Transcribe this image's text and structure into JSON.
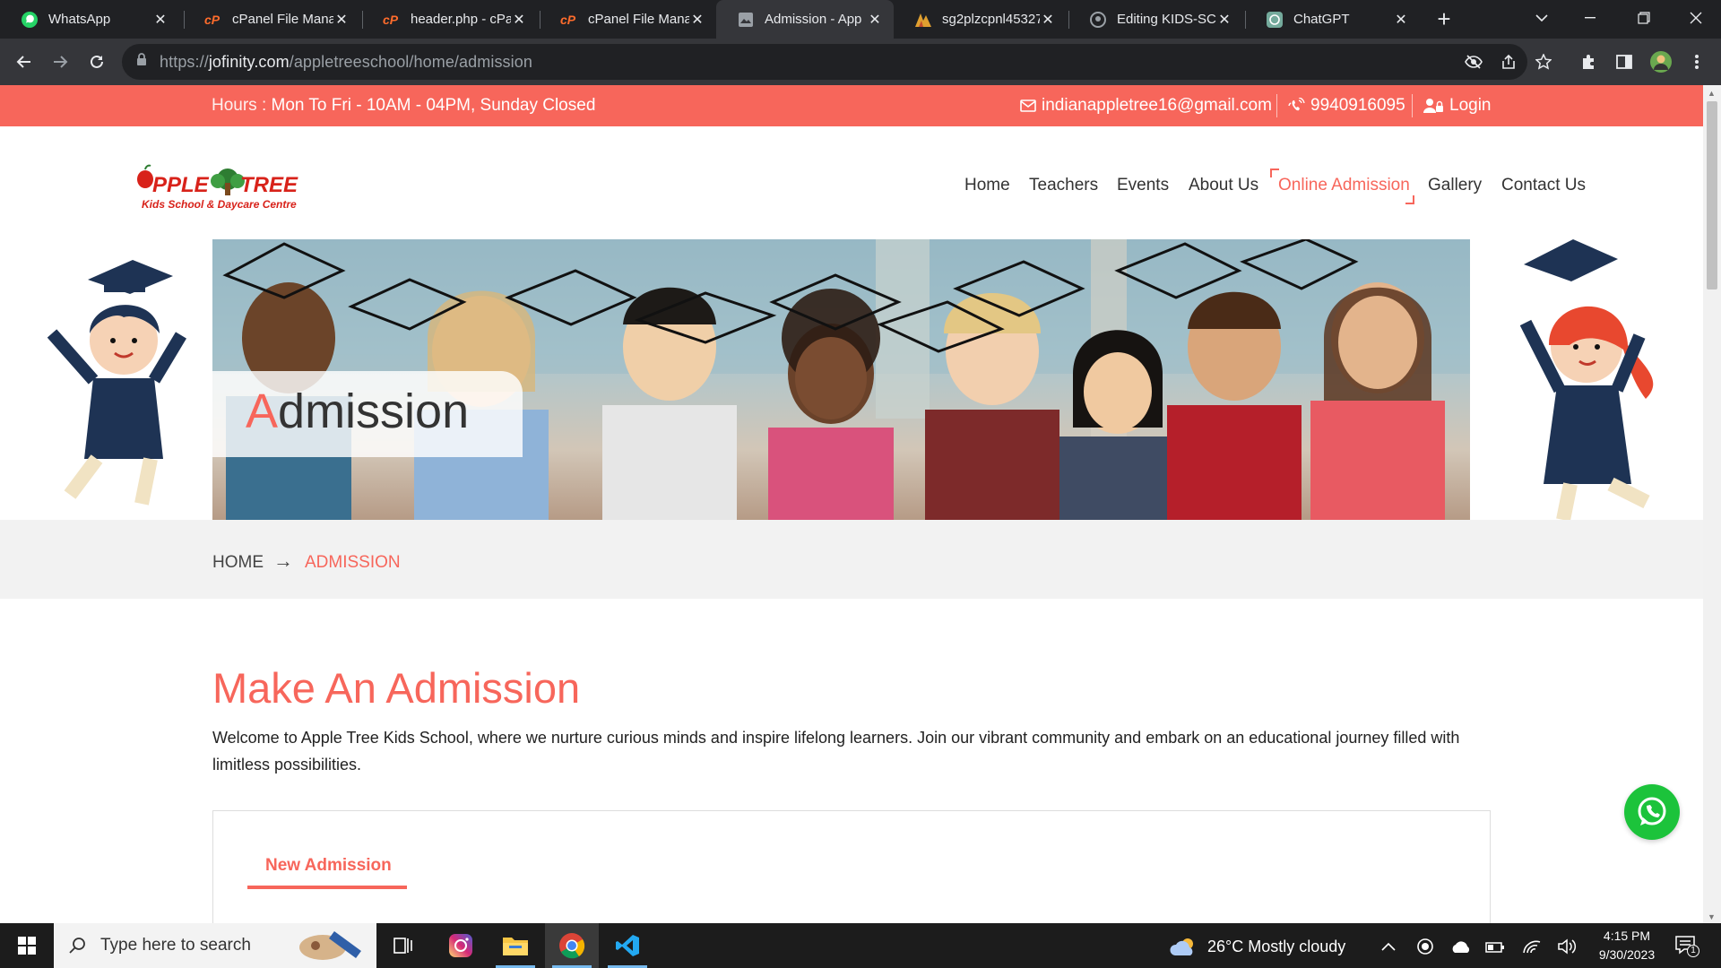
{
  "browser": {
    "tabs": [
      {
        "title": "WhatsApp",
        "icon": "whatsapp-icon"
      },
      {
        "title": "cPanel File Mana",
        "icon": "cpanel-icon"
      },
      {
        "title": "header.php - cPa",
        "icon": "cpanel-icon"
      },
      {
        "title": "cPanel File Mana",
        "icon": "cpanel-icon"
      },
      {
        "title": "Admission - App",
        "icon": "page-icon",
        "active": true
      },
      {
        "title": "sg2plzcpnl45327",
        "icon": "server-icon"
      },
      {
        "title": "Editing KIDS-SCH",
        "icon": "github-icon"
      },
      {
        "title": "ChatGPT",
        "icon": "chatgpt-icon"
      }
    ],
    "url_prefix": "https://",
    "url_domain": "jofinity.com",
    "url_path": "/appletreeschool/home/admission"
  },
  "topbar": {
    "hours_label": "Hours : ",
    "hours_value": "Mon To Fri - 10AM - 04PM, Sunday Closed",
    "email": "indianappletree16@gmail.com",
    "phone": "9940916095",
    "login": "Login"
  },
  "logo": {
    "name": "Apple Tree",
    "tagline": "Kids School & Daycare Centre"
  },
  "nav": {
    "items": [
      {
        "label": "Home"
      },
      {
        "label": "Teachers"
      },
      {
        "label": "Events"
      },
      {
        "label": "About Us"
      },
      {
        "label": "Online Admission",
        "active": true
      },
      {
        "label": "Gallery"
      },
      {
        "label": "Contact Us"
      }
    ]
  },
  "banner": {
    "title_first": "A",
    "title_rest": "dmission"
  },
  "breadcrumb": {
    "home": "HOME",
    "arrow": "→",
    "current": "ADMISSION"
  },
  "section": {
    "title": "Make An Admission",
    "text": "Welcome to Apple Tree Kids School, where we nurture curious minds and inspire lifelong learners. Join our vibrant community and embark on an educational journey filled with limitless possibilities."
  },
  "form": {
    "tab_label": "New Admission"
  },
  "taskbar": {
    "search_placeholder": "Type here to search",
    "weather": "26°C  Mostly cloudy",
    "time": "4:15 PM",
    "date": "9/30/2023",
    "notification_count": "1"
  },
  "colors": {
    "accent": "#f7665b",
    "whatsapp": "#1cc33b",
    "chrome_dark": "#202124"
  }
}
